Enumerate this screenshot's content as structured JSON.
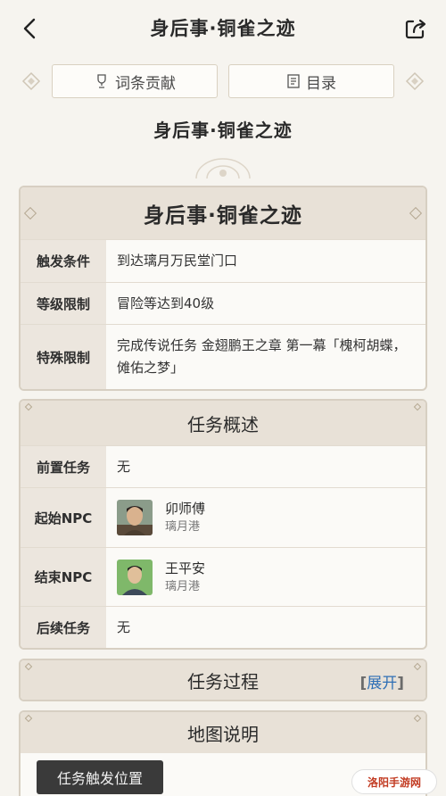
{
  "header": {
    "title": "身后事·铜雀之迹"
  },
  "tabs": {
    "contrib": "词条贡献",
    "toc": "目录"
  },
  "page_title": "身后事·铜雀之迹",
  "info_card": {
    "title": "身后事·铜雀之迹",
    "rows": [
      {
        "label": "触发条件",
        "value": "到达璃月万民堂门口"
      },
      {
        "label": "等级限制",
        "value": "冒险等达到40级"
      },
      {
        "label": "特殊限制",
        "value": "完成传说任务 金翅鹏王之章 第一幕「槐柯胡蝶，傩佑之梦」"
      }
    ]
  },
  "overview_card": {
    "title": "任务概述",
    "pre_task": {
      "label": "前置任务",
      "value": "无"
    },
    "start_npc": {
      "label": "起始NPC",
      "name": "卯师傅",
      "place": "璃月港"
    },
    "end_npc": {
      "label": "结束NPC",
      "name": "王平安",
      "place": "璃月港"
    },
    "post_task": {
      "label": "后续任务",
      "value": "无"
    }
  },
  "process_card": {
    "title": "任务过程",
    "expand": "展开",
    "bracket_open": "[",
    "bracket_close": "]"
  },
  "map_card": {
    "title": "地图说明",
    "trigger_button": "任务触发位置"
  },
  "watermark": {
    "text": "洛阳手游网"
  }
}
